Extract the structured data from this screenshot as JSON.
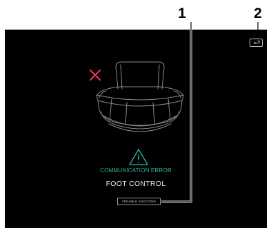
{
  "callouts": {
    "one": "1",
    "two": "2"
  },
  "screen": {
    "background_color": "#000000",
    "illustration": "foot-control-illustration",
    "error_marker_icon": "x-icon",
    "error_marker_color": "#e8365a",
    "warning_icon": "warning-triangle-icon",
    "accent_color": "#2fb8a4",
    "back_button_icon": "return-arrow-icon"
  },
  "error": {
    "title": "COMMUNICATION ERROR",
    "subtitle": "FOOT CONTROL"
  },
  "troubleshooting_button": {
    "label": "TROUBLE SHOOTING"
  }
}
